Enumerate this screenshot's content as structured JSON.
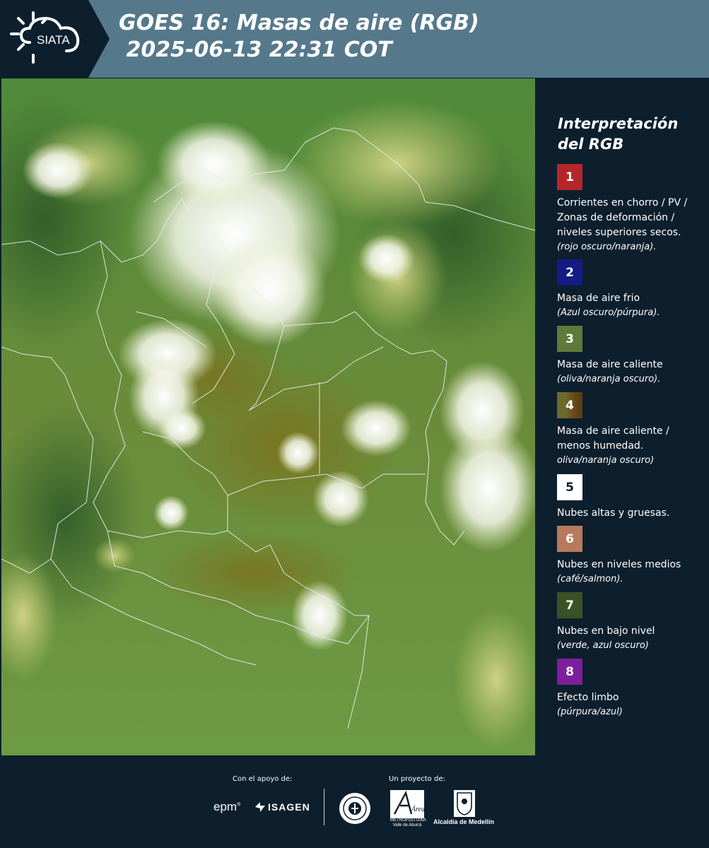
{
  "header": {
    "logo_text": "SIATA",
    "title_line1": "GOES 16: Masas de aire (RGB)",
    "title_line2": " 2025-06-13 22:31 COT"
  },
  "legend": {
    "title": "Interpretación del RGB",
    "items": [
      {
        "num": "1",
        "color": "#b5262a",
        "text": "Corrientes en chorro / PV / Zonas de deformación / niveles superiores secos.",
        "note": "(rojo oscuro/naranja)."
      },
      {
        "num": "2",
        "color": "#141b85",
        "text": "Masa de aire frio",
        "note": "(Azul oscuro/púrpura)."
      },
      {
        "num": "3",
        "color": "#5d7a3b",
        "text": "Masa de aire caliente",
        "note": "(oliva/naranja oscuro)."
      },
      {
        "num": "4",
        "color": "#6b5423",
        "text": "Masa de aire caliente / menos humedad.",
        "note": "oliva/naranja oscuro)"
      },
      {
        "num": "5",
        "color": "#ffffff",
        "text": "Nubes altas y gruesas.",
        "note": ""
      },
      {
        "num": "6",
        "color": "#b87a5c",
        "text": "Nubes en niveles medios",
        "note": "(café/salmon)."
      },
      {
        "num": "7",
        "color": "#3a5226",
        "text": "Nubes en bajo nivel",
        "note": "(verde, azul oscuro)"
      },
      {
        "num": "8",
        "color": "#7d1f9d",
        "text": "Efecto limbo",
        "note": "(púrpura/azul)"
      }
    ]
  },
  "footer": {
    "support_label": "Con el apoyo de:",
    "project_label": "Un proyecto de:",
    "sponsor1": "epm",
    "sponsor2": "ISAGEN",
    "partner1_line1": "Área",
    "partner1_line2": "METROPOLITANA",
    "partner1_line3": "Valle de Aburrá",
    "partner2": "Alcaldía de Medellín"
  }
}
